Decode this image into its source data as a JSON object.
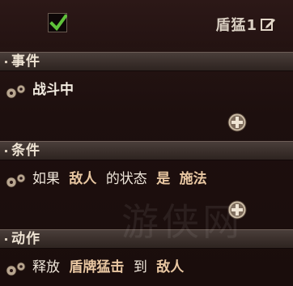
{
  "header": {
    "rule_name": "盾猛1",
    "enabled": true
  },
  "sections": {
    "event": {
      "title": "事件",
      "row_text": "战斗中"
    },
    "condition": {
      "title": "条件",
      "row": [
        "如果",
        "敌人",
        "的状态",
        "是",
        "施法"
      ]
    },
    "action": {
      "title": "动作",
      "row": [
        "释放",
        "盾牌猛击",
        "到",
        "敌人"
      ]
    }
  },
  "watermark": "游侠网",
  "icons": {
    "checkbox": "check-icon",
    "edit": "edit-icon",
    "add": "plus-circle-icon",
    "gears": "gears-icon"
  },
  "colors": {
    "check_green": "#5fc23a",
    "keyword": "#e9c7a2"
  }
}
